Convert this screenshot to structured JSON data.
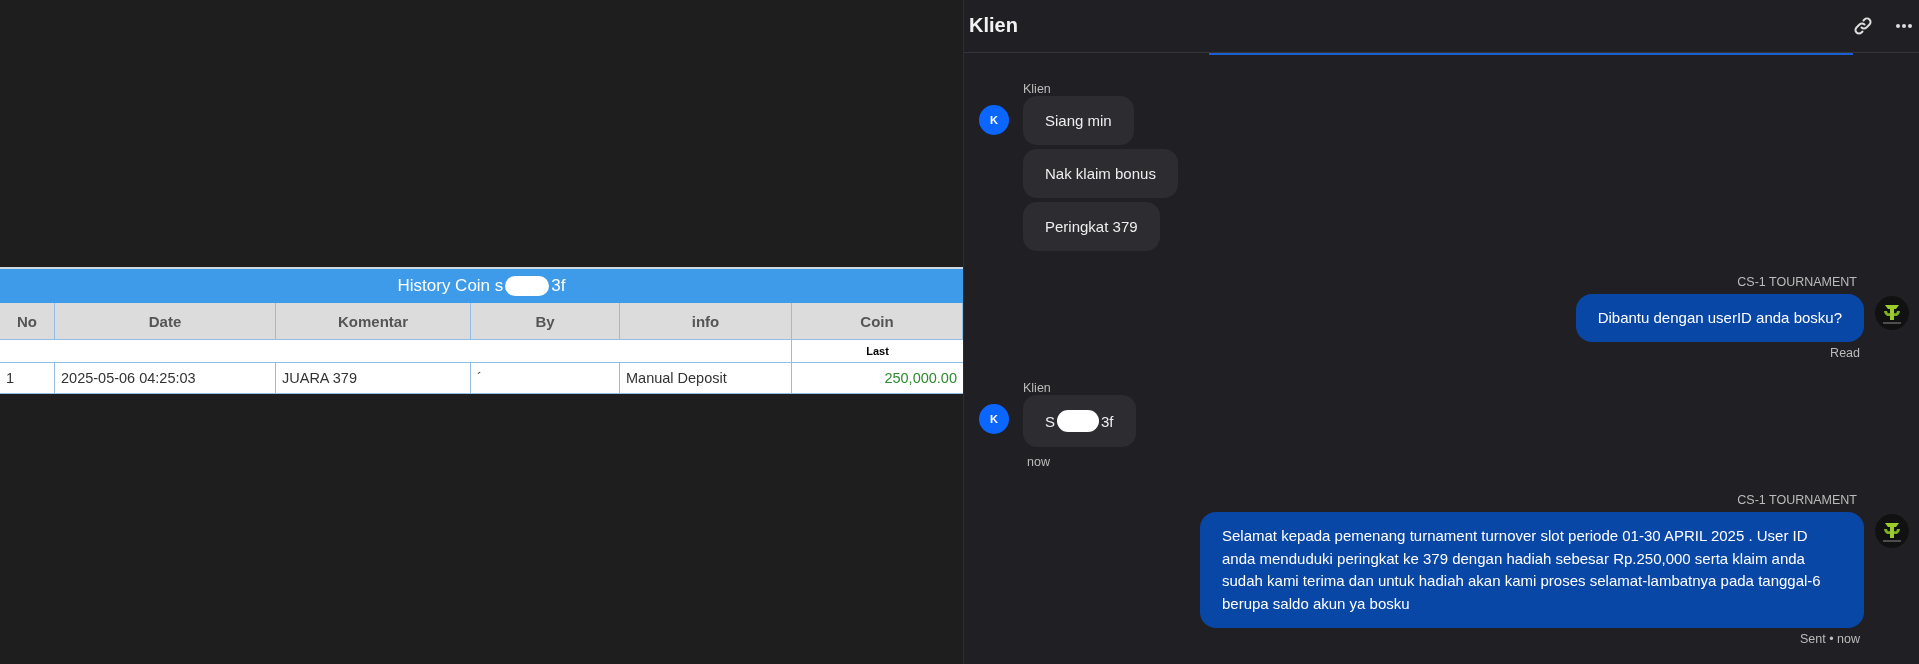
{
  "table": {
    "title": "History Coin s",
    "title_after_redaction": "3f",
    "columns": [
      "No",
      "Date",
      "Komentar",
      "By",
      "info",
      "Coin"
    ],
    "subheader": {
      "coin": "Last"
    },
    "rows": [
      {
        "no": "1",
        "date": "2025-05-06 04:25:03",
        "komentar": "JUARA 379",
        "by": "´",
        "info": "Manual Deposit",
        "coin": "250,000.00"
      }
    ]
  },
  "chat": {
    "title": "Klien",
    "messages": [
      {
        "kind": "incoming",
        "sender": "Klien",
        "avatar": "K",
        "bubbles": [
          {
            "text": "Siang min"
          },
          {
            "text": "Nak klaim bonus"
          },
          {
            "text": "Peringkat 379"
          }
        ]
      },
      {
        "kind": "outgoing",
        "sender": "CS-1 TOURNAMENT",
        "bubbles": [
          {
            "text": "Dibantu dengan userID anda bosku?"
          }
        ],
        "status": "Read"
      },
      {
        "kind": "incoming",
        "sender": "Klien",
        "avatar": "K",
        "bubbles": [
          {
            "text": "S",
            "after_redaction": "3f"
          }
        ],
        "status": "now"
      },
      {
        "kind": "outgoing",
        "sender": "CS-1 TOURNAMENT",
        "bubbles": [
          {
            "text": "Selamat kepada pemenang turnament turnover slot periode 01-30 APRIL 2025 . User ID anda menduduki peringkat ke 379 dengan hadiah sebesar Rp.250,000 serta klaim anda sudah kami terima dan untuk hadiah akan kami proses selamat-lambatnya pada tanggal-6 berupa saldo akun ya bosku"
          }
        ],
        "status": "Sent • now"
      }
    ]
  }
}
